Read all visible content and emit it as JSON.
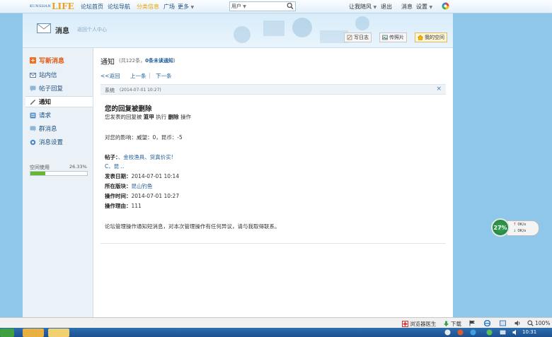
{
  "topnav": {
    "logo_small": "KUNSHAN",
    "logo_big": "LIFE",
    "links": [
      "论坛首页",
      "论坛导航",
      "分类信息",
      "广场",
      "更多"
    ],
    "search_scope": "用户",
    "user": "让我随风",
    "logout": "退出",
    "messages": "消息",
    "settings": "设置"
  },
  "header": {
    "title": "消息",
    "back": "返回个人中心",
    "buttons": [
      "写日志",
      "传照片",
      "我的空间"
    ]
  },
  "sidebar": {
    "compose": "写新消息",
    "items": [
      "站内信",
      "帖子回复",
      "通知",
      "请求",
      "群消息",
      "消息设置"
    ],
    "quota_label": "空间使用",
    "quota_value": "26.33%",
    "quota_fraction": 0.2633
  },
  "main": {
    "title": "通知",
    "count_prefix": "(共122条，",
    "unread": "0条未读通知",
    "count_suffix": ")",
    "back": "<<返回",
    "prev": "上一条",
    "next": "下一条",
    "sender": "系统",
    "time": "(2014-07-01 10:27)",
    "close": "×",
    "heading": "您的回复被删除",
    "line1_a": "您发表的回复被",
    "line1_b": "篮甲",
    "line1_c": "执行",
    "line1_d": "删除",
    "line1_e": "操作",
    "effect": "对您的影响：威望：0，昆币：-5",
    "post_label": "帖子：",
    "post_link_1": "、金校渔具、货真价实!",
    "post_link_2": "C、昆 ..",
    "date_label": "发表日期：",
    "date_value": "2014-07-01 10:14",
    "board_label": "所在版块：",
    "board_value": "昆山钓鱼",
    "optime_label": "操作时间：",
    "optime_value": "2014-07-01 10:27",
    "reason_label": "操作理由：",
    "reason_value": "111",
    "footer": "论坛管理操作通知短消息，对本次管理操作有任何异议，请与我取得联系。"
  },
  "speed": {
    "percent": "27%",
    "up": "0K/s",
    "down": "0K/s"
  },
  "statusbar": {
    "doctor": "浏览器医生",
    "download": "下载",
    "zoom": "100%"
  },
  "taskbar": {
    "clock": "10:31"
  }
}
